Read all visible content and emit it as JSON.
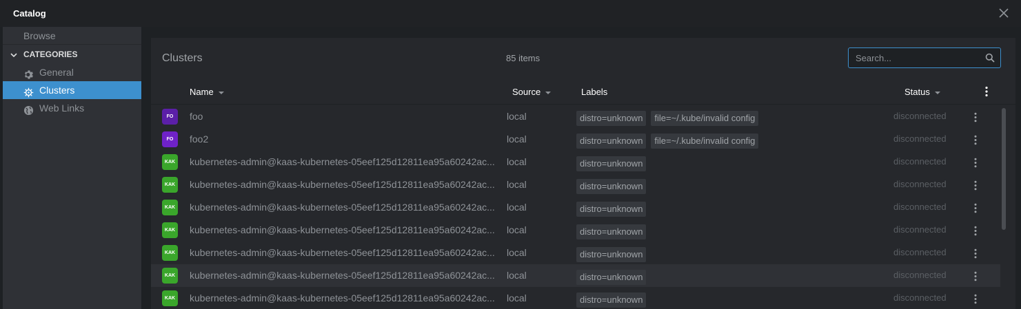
{
  "window": {
    "title": "Catalog",
    "close_icon": "close-icon"
  },
  "sidebar": {
    "browse_label": "Browse",
    "categories_heading": "CATEGORIES",
    "items": [
      {
        "label": "General",
        "icon": "gear-icon",
        "active": false
      },
      {
        "label": "Clusters",
        "icon": "helm-icon",
        "active": true
      },
      {
        "label": "Web Links",
        "icon": "globe-icon",
        "active": false
      }
    ]
  },
  "panel": {
    "title": "Clusters",
    "item_count": "85 items",
    "search": {
      "placeholder": "Search...",
      "value": ""
    }
  },
  "table": {
    "columns": [
      {
        "label": "Name",
        "sortable": true
      },
      {
        "label": "Source",
        "sortable": true
      },
      {
        "label": "Labels",
        "sortable": false
      },
      {
        "label": "Status",
        "sortable": true
      }
    ],
    "rows": [
      {
        "avatar": "FO",
        "avatar_color": "#5b1fa8",
        "name": "foo",
        "source": "local",
        "labels": [
          "distro=unknown",
          "file=~/.kube/invalid config"
        ],
        "status": "disconnected"
      },
      {
        "avatar": "FO",
        "avatar_color": "#6f22c8",
        "name": "foo2",
        "source": "local",
        "labels": [
          "distro=unknown",
          "file=~/.kube/invalid config"
        ],
        "status": "disconnected"
      },
      {
        "avatar": "KAK",
        "avatar_color": "#3aa62b",
        "name": "kubernetes-admin@kaas-kubernetes-05eef125d12811ea95a60242ac...",
        "source": "local",
        "labels": [
          "distro=unknown"
        ],
        "status": "disconnected"
      },
      {
        "avatar": "KAK",
        "avatar_color": "#3aa62b",
        "name": "kubernetes-admin@kaas-kubernetes-05eef125d12811ea95a60242ac...",
        "source": "local",
        "labels": [
          "distro=unknown"
        ],
        "status": "disconnected"
      },
      {
        "avatar": "KAK",
        "avatar_color": "#3aa62b",
        "name": "kubernetes-admin@kaas-kubernetes-05eef125d12811ea95a60242ac...",
        "source": "local",
        "labels": [
          "distro=unknown"
        ],
        "status": "disconnected"
      },
      {
        "avatar": "KAK",
        "avatar_color": "#3aa62b",
        "name": "kubernetes-admin@kaas-kubernetes-05eef125d12811ea95a60242ac...",
        "source": "local",
        "labels": [
          "distro=unknown"
        ],
        "status": "disconnected"
      },
      {
        "avatar": "KAK",
        "avatar_color": "#3aa62b",
        "name": "kubernetes-admin@kaas-kubernetes-05eef125d12811ea95a60242ac...",
        "source": "local",
        "labels": [
          "distro=unknown"
        ],
        "status": "disconnected"
      },
      {
        "avatar": "KAK",
        "avatar_color": "#3aa62b",
        "name": "kubernetes-admin@kaas-kubernetes-05eef125d12811ea95a60242ac...",
        "source": "local",
        "labels": [
          "distro=unknown"
        ],
        "status": "disconnected",
        "hover": true
      },
      {
        "avatar": "KAK",
        "avatar_color": "#3aa62b",
        "name": "kubernetes-admin@kaas-kubernetes-05eef125d12811ea95a60242ac...",
        "source": "local",
        "labels": [
          "distro=unknown"
        ],
        "status": "disconnected"
      }
    ]
  },
  "colors": {
    "accent": "#3d90ce",
    "background": "#1e2124",
    "sidebar": "#2f3136",
    "panel": "#26282c"
  }
}
